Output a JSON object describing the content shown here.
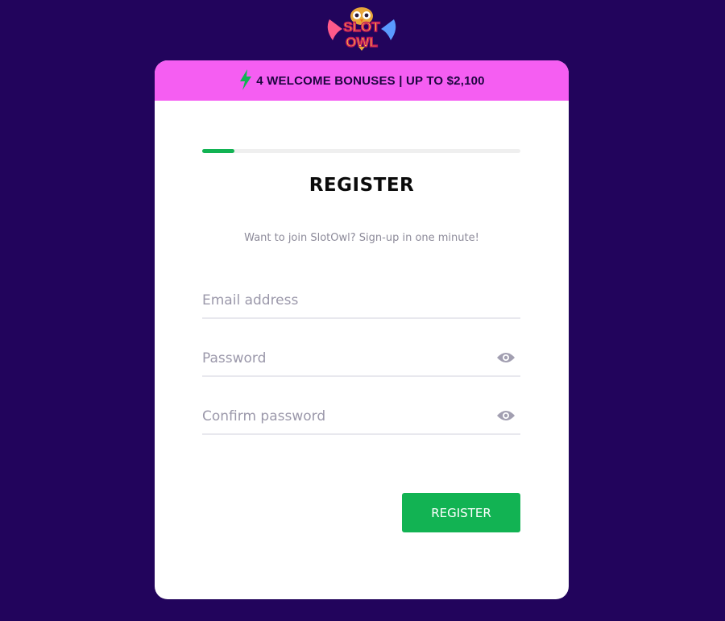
{
  "brand": {
    "logo_text": "SLOT OWL",
    "colors": {
      "page_bg": "#22045c",
      "banner_bg": "#f55ef2",
      "accent": "#12b353"
    }
  },
  "banner": {
    "icon": "lightning-bolt-icon",
    "text": "4 WELCOME BONUSES | UP TO $2,100"
  },
  "progress": {
    "value_percent": 10
  },
  "form": {
    "title": "REGISTER",
    "subtitle": "Want to join SlotOwl? Sign-up in one minute!",
    "email": {
      "placeholder": "Email address",
      "value": ""
    },
    "password": {
      "placeholder": "Password",
      "value": "",
      "icon": "eye-icon"
    },
    "confirm_password": {
      "placeholder": "Confirm password",
      "value": "",
      "icon": "eye-icon"
    },
    "submit_label": "REGISTER"
  }
}
